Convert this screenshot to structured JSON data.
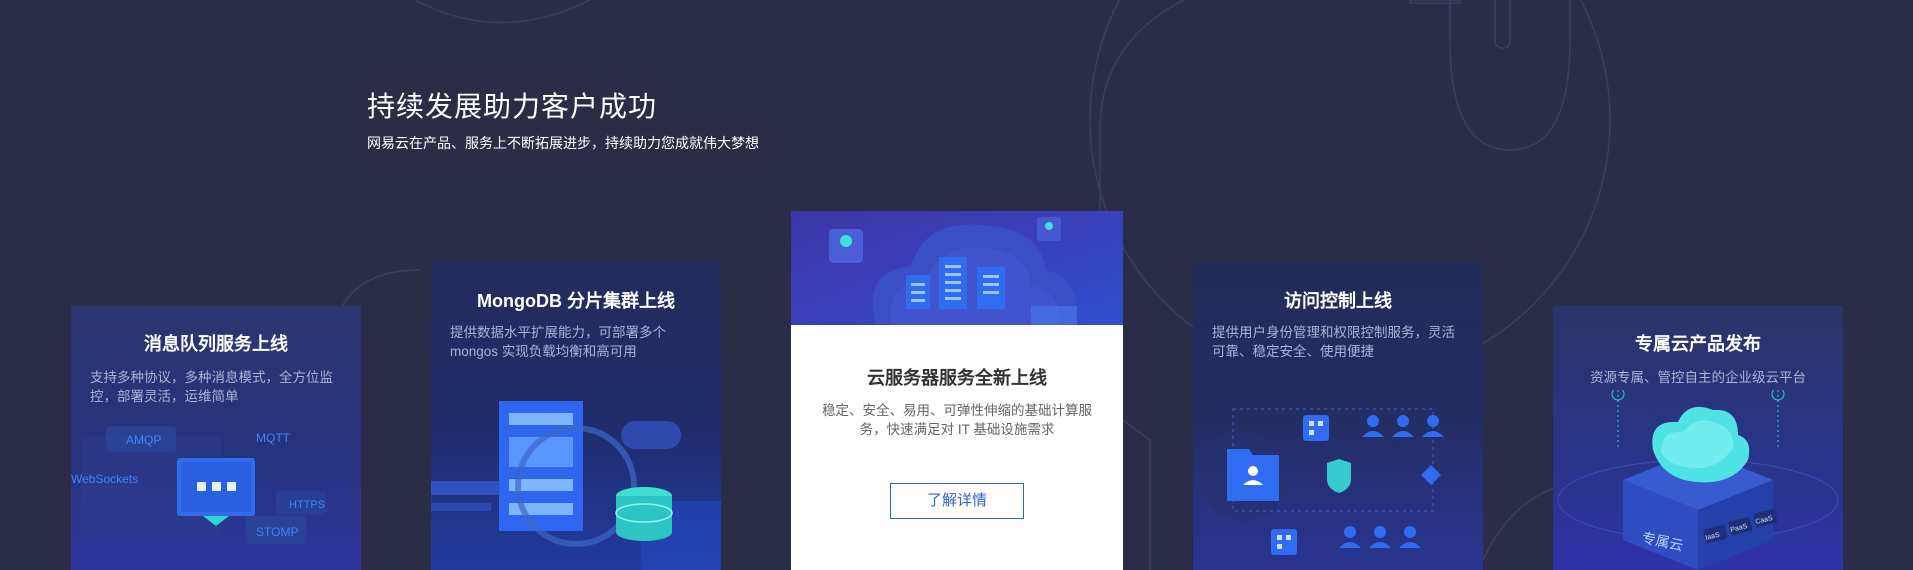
{
  "section": {
    "title": "持续发展助力客户成功",
    "subtitle": "网易云在产品、服务上不断拓展进步，持续助力您成就伟大梦想"
  },
  "cards": [
    {
      "title": "消息队列服务上线",
      "desc": "支持多种协议，多种消息模式，全方位监控，部署灵活，运维简单",
      "protocols": [
        "AMQP",
        "MQTT",
        "WebSockets",
        "HTTPS",
        "STOMP"
      ]
    },
    {
      "title": "MongoDB 分片集群上线",
      "desc": "提供数据水平扩展能力，可部署多个 mongos 实现负载均衡和高可用"
    },
    {
      "title": "云服务器服务全新上线",
      "desc": "稳定、安全、易用、可弹性伸缩的基础计算服务，快速满足对 IT 基础设施需求",
      "button": "了解详情"
    },
    {
      "title": "访问控制上线",
      "desc": "提供用户身份管理和权限控制服务，灵活可靠、稳定安全、使用便捷"
    },
    {
      "title": "专属云产品发布",
      "desc": "资源专属、管控自主的企业级云平台",
      "box_label": "专属云",
      "tags": [
        "IaaS",
        "PaaS",
        "CaaS"
      ]
    }
  ],
  "colors": {
    "background": "#2b2d48",
    "accent": "#2e63d6"
  }
}
